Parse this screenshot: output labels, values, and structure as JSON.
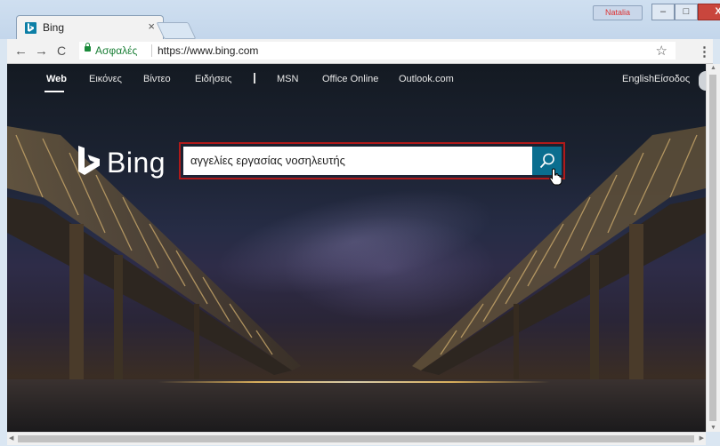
{
  "browser": {
    "tab": {
      "title": "Bing",
      "close": "×"
    },
    "user_badge": "Natalia",
    "window_buttons": {
      "minimize": "–",
      "maximize": "□",
      "close": "X"
    },
    "nav": {
      "back": "←",
      "forward": "→",
      "reload": "C"
    },
    "address": {
      "secure_label": "Ασφαλές",
      "url": "https://www.bing.com"
    },
    "star": "☆",
    "menu": "⋮"
  },
  "bing": {
    "nav_left": [
      "Web",
      "Εικόνες",
      "Βίντεο",
      "Ειδήσεις",
      "MSN",
      "Office Online",
      "Outlook.com"
    ],
    "nav_right": {
      "language": "English",
      "signin": "Είσοδος"
    },
    "logo_text": "Bing",
    "search_value": "αγγελίες εργασίας νοσηλευτής"
  },
  "colors": {
    "accent": "#0a6e8f",
    "highlight_border": "#b01a1a",
    "secure_green": "#1a7f36"
  }
}
